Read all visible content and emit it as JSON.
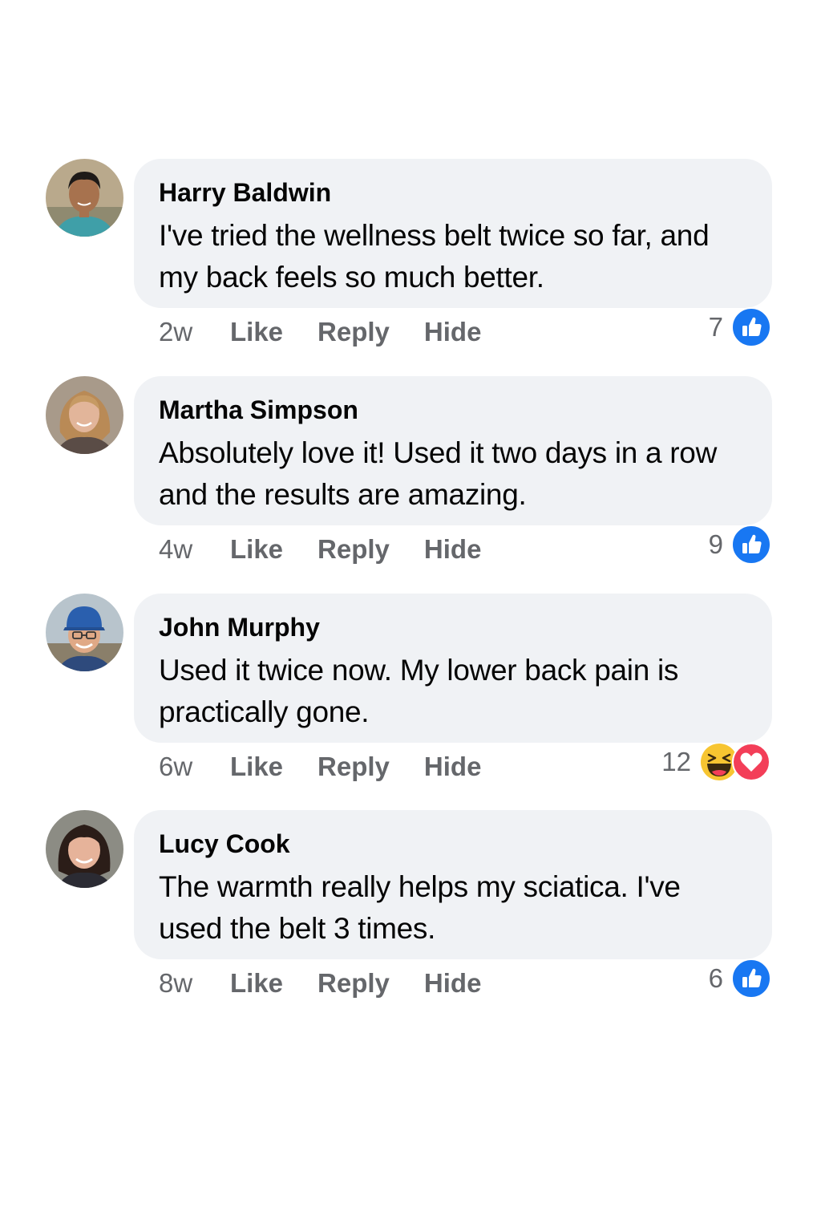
{
  "comments": [
    {
      "author": "Harry Baldwin",
      "text": "I've tried the wellness belt twice so far, and my back feels so much better.",
      "time": "2w",
      "actions": [
        "Like",
        "Reply",
        "Hide"
      ],
      "reaction_count": "7",
      "reactions": [
        "like-icon"
      ]
    },
    {
      "author": "Martha Simpson",
      "text": "Absolutely love it! Used it two days in a row and the results are amazing.",
      "time": "4w",
      "actions": [
        "Like",
        "Reply",
        "Hide"
      ],
      "reaction_count": "9",
      "reactions": [
        "like-icon"
      ]
    },
    {
      "author": "John Murphy",
      "text": "Used it twice now. My lower back pain is practically gone.",
      "time": "6w",
      "actions": [
        "Like",
        "Reply",
        "Hide"
      ],
      "reaction_count": "12",
      "reactions": [
        "haha-icon",
        "love-icon"
      ]
    },
    {
      "author": "Lucy Cook",
      "text": "The warmth really helps my sciatica. I've used the belt 3 times.",
      "time": "8w",
      "actions": [
        "Like",
        "Reply",
        "Hide"
      ],
      "reaction_count": "6",
      "reactions": [
        "like-icon"
      ]
    }
  ],
  "colors": {
    "bubble": "#f0f2f5",
    "text": "#050505",
    "muted": "#65676b",
    "like_blue": "#1877f2",
    "haha_yellow": "#f7c531",
    "love_red": "#f33e58"
  }
}
